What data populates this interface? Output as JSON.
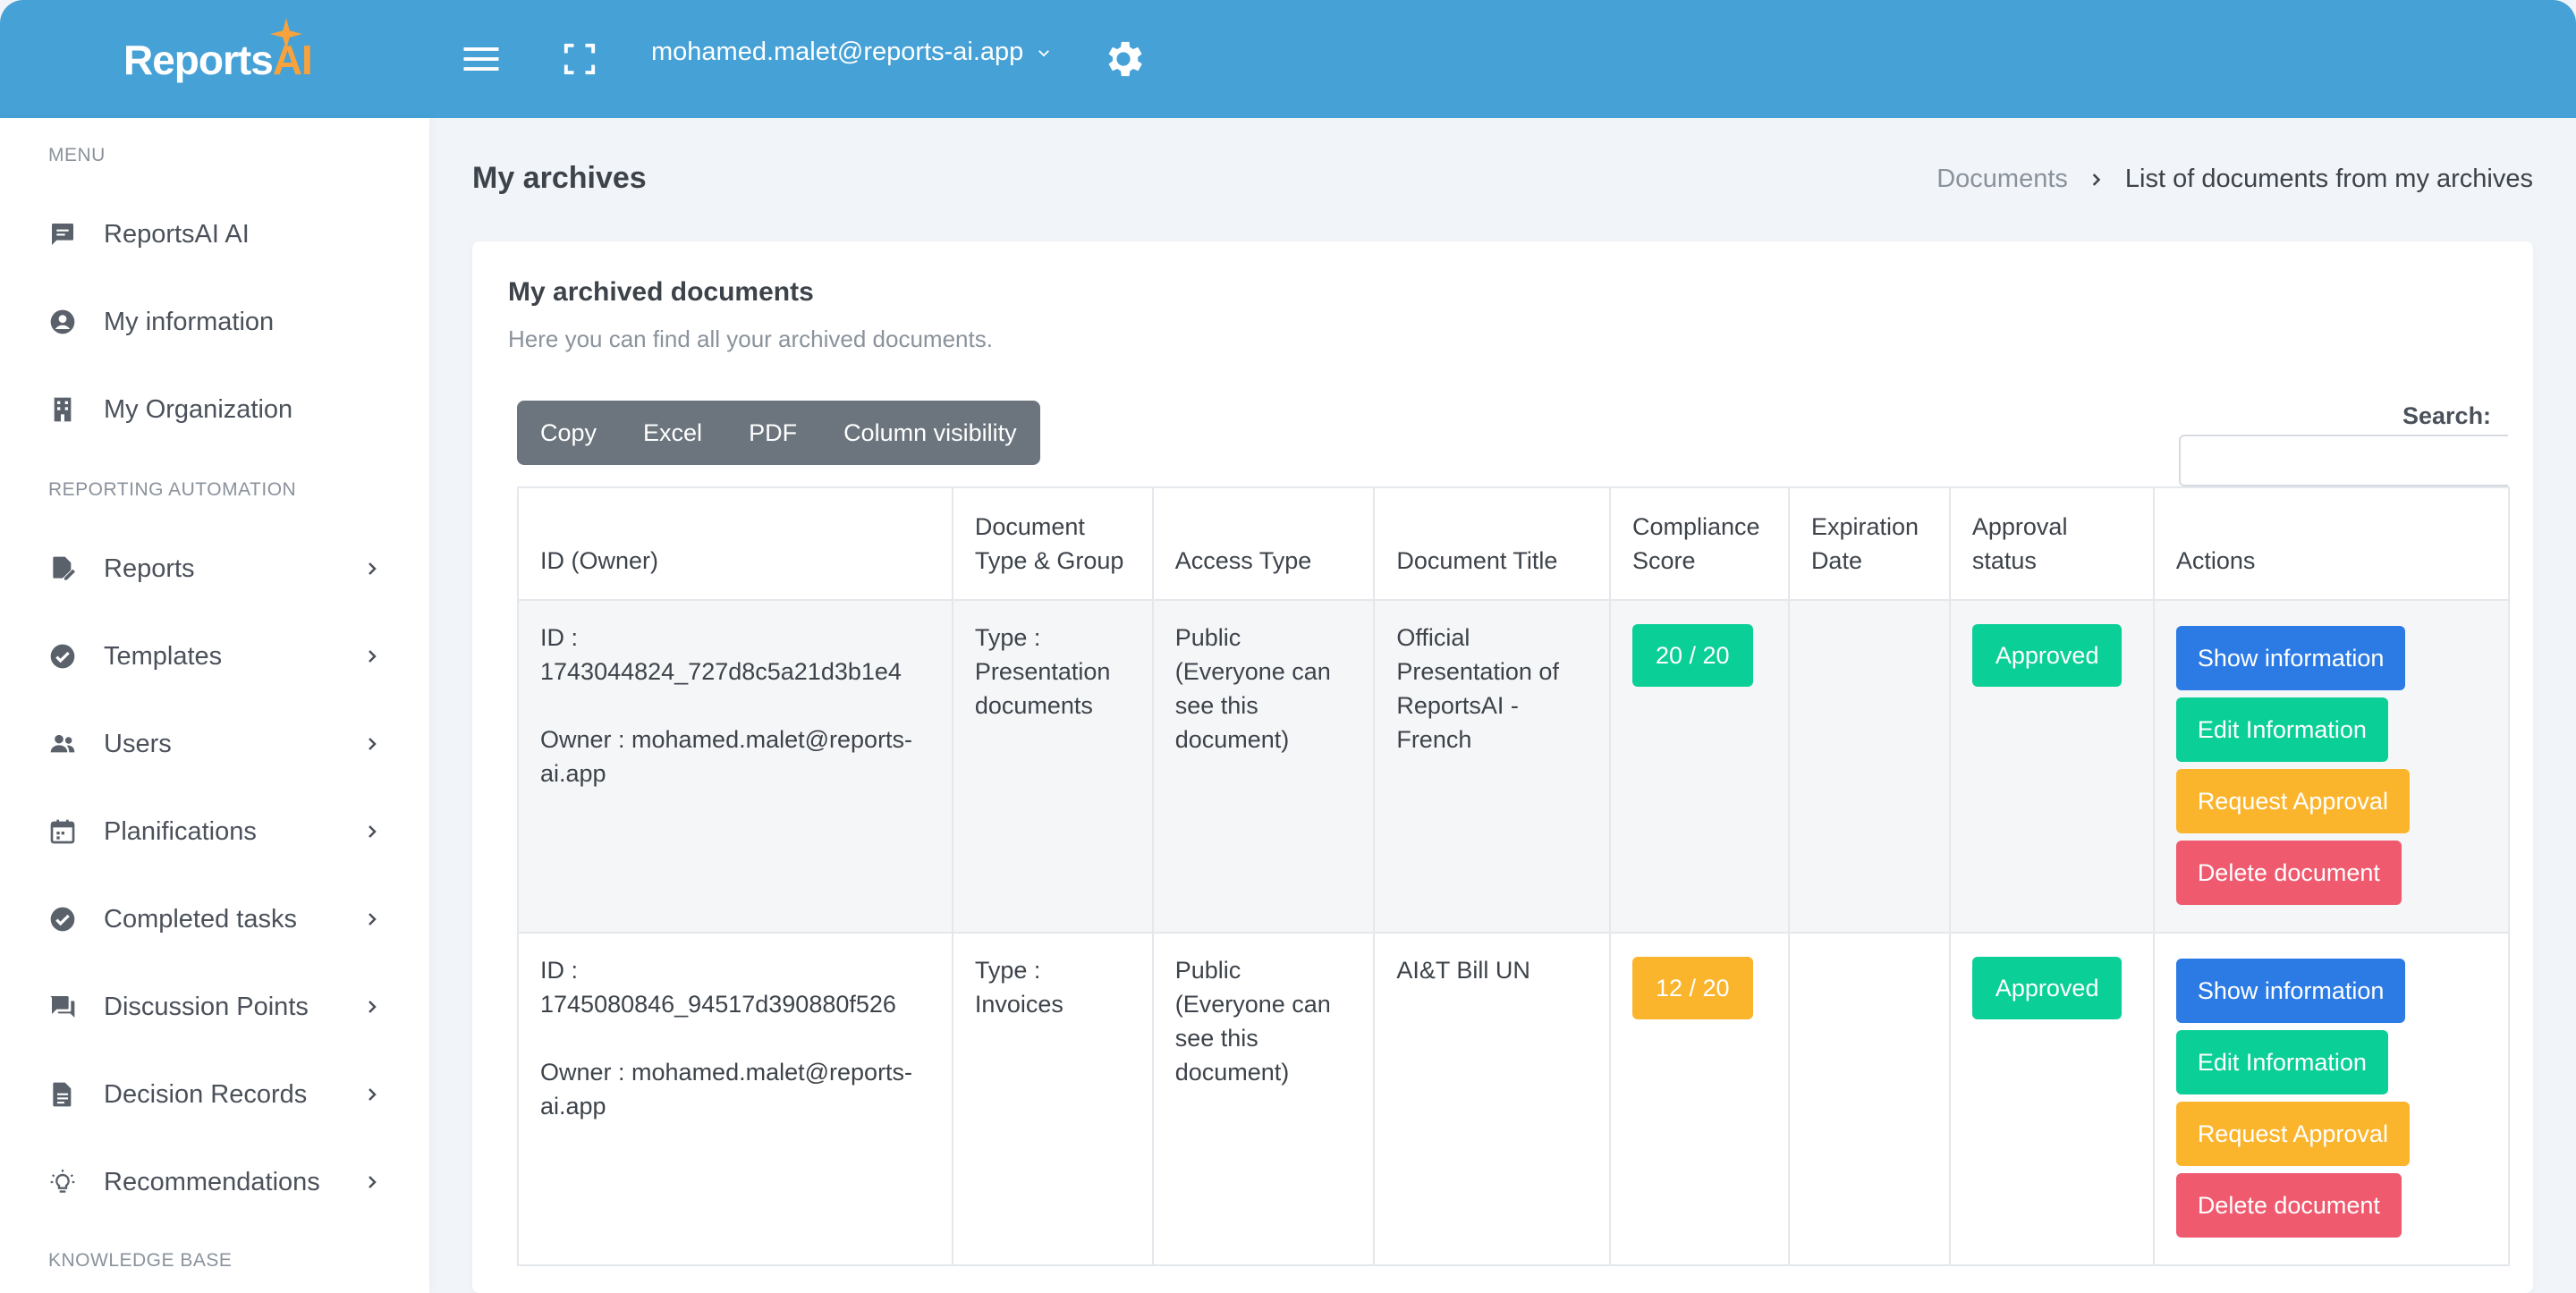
{
  "colors": {
    "topbar": "#45a1d6",
    "logo_accent": "#f7a23c",
    "primary": "#2c7be5",
    "success": "#0acf97",
    "warning": "#fbb52d",
    "danger": "#ef5a6f",
    "secondary": "#6c757d"
  },
  "topbar": {
    "logo_main": "Reports",
    "logo_accent": "AI",
    "user_email": "mohamed.malet@reports-ai.app",
    "icons": [
      "menu-icon",
      "fullscreen-icon",
      "chevron-down-icon",
      "gear-icon"
    ]
  },
  "sidebar": {
    "menu_title": "MENU",
    "reporting_title": "REPORTING AUTOMATION",
    "knowledge_title": "KNOWLEDGE BASE",
    "items": [
      {
        "label": "ReportsAI AI",
        "icon": "chat-icon"
      },
      {
        "label": "My information",
        "icon": "user-circle-icon"
      },
      {
        "label": "My Organization",
        "icon": "building-icon"
      },
      {
        "label": "Reports",
        "icon": "edit-document-icon"
      },
      {
        "label": "Templates",
        "icon": "check-circle-icon"
      },
      {
        "label": "Users",
        "icon": "users-icon"
      },
      {
        "label": "Planifications",
        "icon": "calendar-icon"
      },
      {
        "label": "Completed tasks",
        "icon": "check-circle-icon"
      },
      {
        "label": "Discussion Points",
        "icon": "comments-icon"
      },
      {
        "label": "Decision Records",
        "icon": "document-icon"
      },
      {
        "label": "Recommendations",
        "icon": "lightbulb-icon"
      }
    ]
  },
  "page": {
    "title": "My archives",
    "breadcrumb": {
      "link": "Documents",
      "current": "List of documents from my archives"
    }
  },
  "card": {
    "title": "My archived documents",
    "subtitle": "Here you can find all your archived documents.",
    "buttons": {
      "copy": "Copy",
      "excel": "Excel",
      "pdf": "PDF",
      "colvis": "Column visibility"
    },
    "search_label": "Search:",
    "search_value": ""
  },
  "table": {
    "headers": {
      "id_owner": "ID (Owner)",
      "doc_type": "Document Type & Group",
      "access": "Access Type",
      "title": "Document Title",
      "score": "Compliance Score",
      "expiration": "Expiration Date",
      "approval": "Approval status",
      "actions": "Actions"
    },
    "rows": [
      {
        "id": "ID : 1743044824_727d8c5a21d3b1e4",
        "owner": "Owner : mohamed.malet@reports-ai.app",
        "doc_type": "Type : Presentation documents",
        "access": "Public (Everyone can see this document)",
        "title": "Official Presentation of ReportsAI - French",
        "score": "20 / 20",
        "score_status": "success",
        "expiration": "",
        "approval": "Approved"
      },
      {
        "id": "ID : 1745080846_94517d390880f526",
        "owner": "Owner : mohamed.malet@reports-ai.app",
        "doc_type": "Type : Invoices",
        "access": "Public (Everyone can see this document)",
        "title": "AI&T Bill UN",
        "score": "12 / 20",
        "score_status": "warning",
        "expiration": "",
        "approval": "Approved"
      }
    ],
    "actions": {
      "show": "Show information",
      "edit": "Edit Information",
      "request": "Request Approval",
      "delete": "Delete document"
    }
  }
}
